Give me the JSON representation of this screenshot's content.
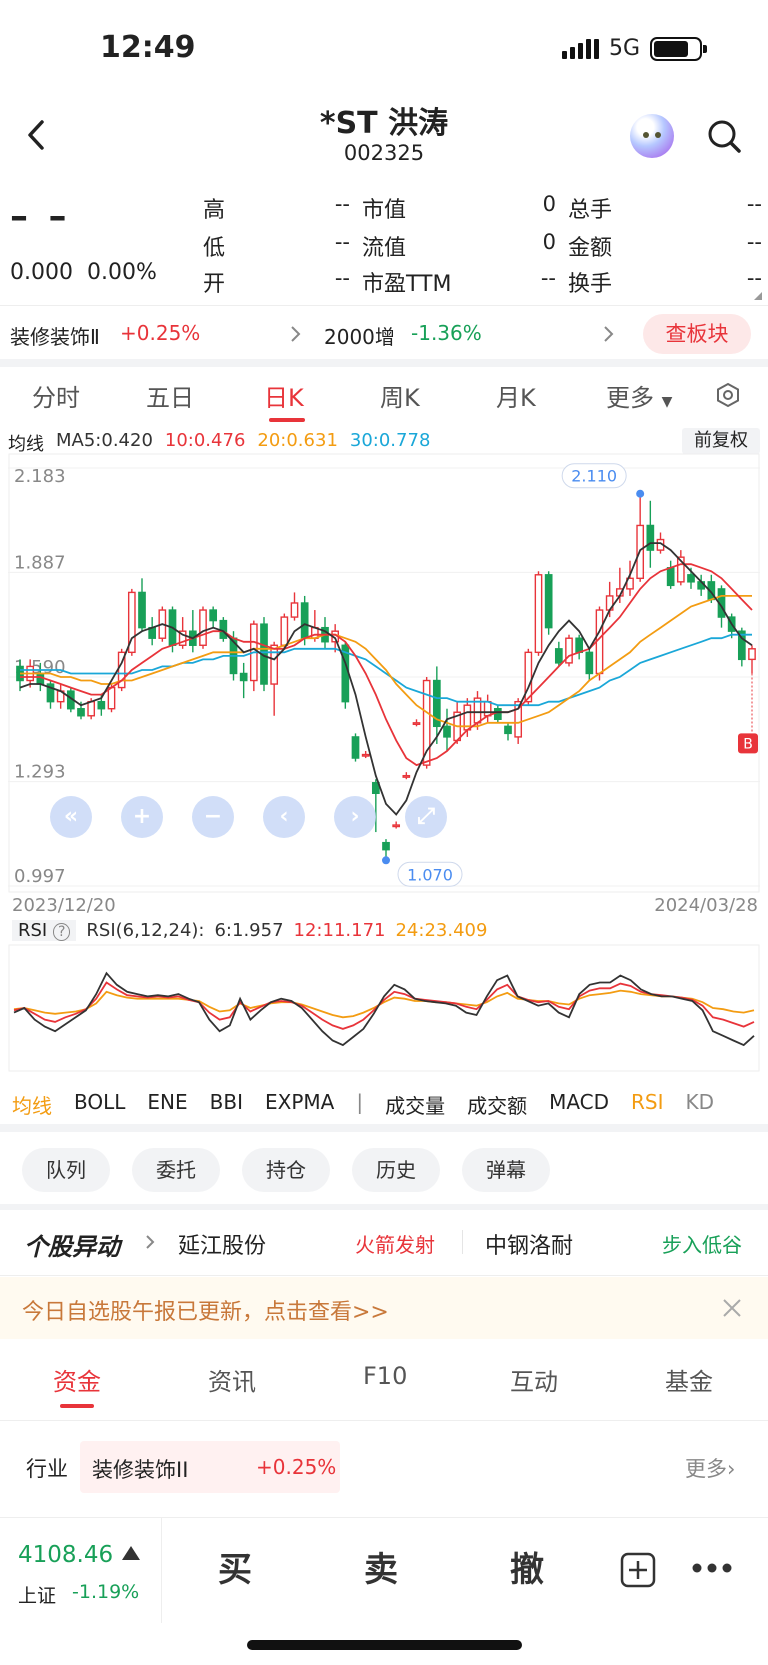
{
  "status_bar": {
    "time": "12:49",
    "network": "5G"
  },
  "header": {
    "title": "*ST 洪涛",
    "code": "002325"
  },
  "quote": {
    "price": "– –",
    "change": "0.000",
    "change_pct": "0.00%",
    "stats": [
      {
        "label": "高",
        "value": "--"
      },
      {
        "label": "低",
        "value": "--"
      },
      {
        "label": "开",
        "value": "--"
      },
      {
        "label": "市值",
        "value": "0"
      },
      {
        "label": "流值",
        "value": "0"
      },
      {
        "label": "市盈TTM",
        "value": "--"
      },
      {
        "label": "总手",
        "value": "--"
      },
      {
        "label": "金额",
        "value": "--"
      },
      {
        "label": "换手",
        "value": "--"
      }
    ]
  },
  "sector": {
    "name": "装修装饰Ⅱ",
    "change": "+0.25%",
    "index_name": "2000增",
    "index_change": "-1.36%",
    "button": "查板块"
  },
  "chart_tabs": [
    "分时",
    "五日",
    "日K",
    "周K",
    "月K",
    "更多"
  ],
  "ma": {
    "label": "均线",
    "ma5": "MA5:0.420",
    "ma10": "10:0.476",
    "ma20": "20:0.631",
    "ma30": "30:0.778",
    "adjust": "前复权"
  },
  "chart_data": [
    {
      "type": "candlestick",
      "y_ticks": [
        "2.183",
        "1.887",
        "1.590",
        "1.293",
        "0.997"
      ],
      "ylim": [
        0.997,
        2.183
      ],
      "x_start": "2023/12/20",
      "x_end": "2024/03/28",
      "high_label": "2.110",
      "low_label": "1.070",
      "colors": {
        "up": "#e8343a",
        "down": "#18a058",
        "ma5": "#333333",
        "ma10": "#e8343a",
        "ma20": "#f39c12",
        "ma30": "#1aa7d8"
      },
      "candles": [
        [
          1.62,
          1.58,
          1.64,
          1.55
        ],
        [
          1.58,
          1.62,
          1.64,
          1.56
        ],
        [
          1.6,
          1.57,
          1.63,
          1.55
        ],
        [
          1.57,
          1.52,
          1.58,
          1.5
        ],
        [
          1.52,
          1.55,
          1.57,
          1.5
        ],
        [
          1.55,
          1.5,
          1.56,
          1.49
        ],
        [
          1.5,
          1.48,
          1.52,
          1.47
        ],
        [
          1.48,
          1.52,
          1.53,
          1.47
        ],
        [
          1.52,
          1.5,
          1.54,
          1.48
        ],
        [
          1.5,
          1.56,
          1.57,
          1.49
        ],
        [
          1.56,
          1.66,
          1.67,
          1.55
        ],
        [
          1.66,
          1.83,
          1.84,
          1.65
        ],
        [
          1.83,
          1.73,
          1.87,
          1.72
        ],
        [
          1.73,
          1.7,
          1.76,
          1.68
        ],
        [
          1.7,
          1.78,
          1.79,
          1.69
        ],
        [
          1.78,
          1.68,
          1.79,
          1.66
        ],
        [
          1.68,
          1.72,
          1.76,
          1.67
        ],
        [
          1.72,
          1.68,
          1.78,
          1.66
        ],
        [
          1.68,
          1.78,
          1.79,
          1.67
        ],
        [
          1.78,
          1.75,
          1.79,
          1.73
        ],
        [
          1.75,
          1.7,
          1.76,
          1.69
        ],
        [
          1.7,
          1.6,
          1.72,
          1.58
        ],
        [
          1.6,
          1.58,
          1.63,
          1.53
        ],
        [
          1.58,
          1.74,
          1.75,
          1.55
        ],
        [
          1.74,
          1.57,
          1.76,
          1.55
        ],
        [
          1.57,
          1.68,
          1.69,
          1.48
        ],
        [
          1.68,
          1.76,
          1.77,
          1.67
        ],
        [
          1.76,
          1.8,
          1.83,
          1.75
        ],
        [
          1.8,
          1.7,
          1.82,
          1.68
        ],
        [
          1.7,
          1.73,
          1.78,
          1.69
        ],
        [
          1.73,
          1.69,
          1.76,
          1.67
        ],
        [
          1.69,
          1.72,
          1.74,
          1.66
        ],
        [
          1.68,
          1.52,
          1.69,
          1.5
        ],
        [
          1.42,
          1.36,
          1.43,
          1.35
        ],
        [
          1.37,
          1.37,
          1.38,
          1.36
        ],
        [
          1.29,
          1.26,
          1.3,
          1.15
        ],
        [
          1.12,
          1.1,
          1.13,
          1.07
        ],
        [
          1.17,
          1.17,
          1.18,
          1.16
        ],
        [
          1.31,
          1.31,
          1.32,
          1.3
        ],
        [
          1.46,
          1.46,
          1.47,
          1.45
        ],
        [
          1.34,
          1.58,
          1.59,
          1.33
        ],
        [
          1.58,
          1.45,
          1.62,
          1.4
        ],
        [
          1.45,
          1.42,
          1.5,
          1.38
        ],
        [
          1.41,
          1.49,
          1.52,
          1.4
        ],
        [
          1.44,
          1.51,
          1.53,
          1.42
        ],
        [
          1.46,
          1.53,
          1.55,
          1.44
        ],
        [
          1.48,
          1.52,
          1.54,
          1.46
        ],
        [
          1.5,
          1.47,
          1.51,
          1.46
        ],
        [
          1.45,
          1.43,
          1.46,
          1.41
        ],
        [
          1.42,
          1.52,
          1.53,
          1.4
        ],
        [
          1.52,
          1.66,
          1.67,
          1.51
        ],
        [
          1.66,
          1.88,
          1.89,
          1.65
        ],
        [
          1.88,
          1.73,
          1.89,
          1.71
        ],
        [
          1.67,
          1.63,
          1.69,
          1.62
        ],
        [
          1.63,
          1.7,
          1.71,
          1.62
        ],
        [
          1.7,
          1.66,
          1.71,
          1.64
        ],
        [
          1.66,
          1.6,
          1.67,
          1.58
        ],
        [
          1.6,
          1.78,
          1.79,
          1.58
        ],
        [
          1.78,
          1.82,
          1.86,
          1.76
        ],
        [
          1.82,
          1.84,
          1.9,
          1.8
        ],
        [
          1.84,
          1.87,
          1.92,
          1.82
        ],
        [
          1.87,
          2.02,
          2.11,
          1.86
        ],
        [
          2.02,
          1.95,
          2.09,
          1.9
        ],
        [
          1.95,
          1.98,
          2.0,
          1.94
        ],
        [
          1.9,
          1.85,
          1.92,
          1.84
        ],
        [
          1.86,
          1.93,
          1.95,
          1.85
        ],
        [
          1.88,
          1.86,
          1.9,
          1.84
        ],
        [
          1.86,
          1.84,
          1.88,
          1.82
        ],
        [
          1.86,
          1.81,
          1.88,
          1.8
        ],
        [
          1.84,
          1.76,
          1.85,
          1.73
        ],
        [
          1.76,
          1.72,
          1.77,
          1.7
        ],
        [
          1.72,
          1.64,
          1.73,
          1.62
        ],
        [
          1.64,
          1.67,
          1.68,
          1.6
        ]
      ],
      "ma5": [
        1.56,
        1.57,
        1.57,
        1.56,
        1.55,
        1.53,
        1.51,
        1.52,
        1.53,
        1.58,
        1.63,
        1.7,
        1.72,
        1.73,
        1.74,
        1.73,
        1.71,
        1.7,
        1.72,
        1.73,
        1.72,
        1.69,
        1.66,
        1.67,
        1.65,
        1.64,
        1.67,
        1.72,
        1.74,
        1.73,
        1.72,
        1.7,
        1.63,
        1.54,
        1.42,
        1.31,
        1.23,
        1.2,
        1.24,
        1.32,
        1.38,
        1.42,
        1.47,
        1.48,
        1.49,
        1.49,
        1.49,
        1.49,
        1.49,
        1.5,
        1.56,
        1.63,
        1.68,
        1.72,
        1.75,
        1.72,
        1.67,
        1.72,
        1.78,
        1.82,
        1.88,
        1.95,
        1.97,
        1.97,
        1.95,
        1.92,
        1.89,
        1.86,
        1.83,
        1.79,
        1.74,
        1.7,
        1.68
      ],
      "ma10": [
        1.59,
        1.59,
        1.59,
        1.58,
        1.57,
        1.56,
        1.55,
        1.54,
        1.54,
        1.56,
        1.58,
        1.61,
        1.63,
        1.65,
        1.67,
        1.68,
        1.69,
        1.7,
        1.71,
        1.72,
        1.72,
        1.7,
        1.69,
        1.69,
        1.68,
        1.67,
        1.67,
        1.68,
        1.7,
        1.71,
        1.71,
        1.71,
        1.69,
        1.65,
        1.6,
        1.54,
        1.47,
        1.41,
        1.36,
        1.34,
        1.35,
        1.36,
        1.38,
        1.41,
        1.44,
        1.46,
        1.48,
        1.49,
        1.49,
        1.5,
        1.53,
        1.56,
        1.59,
        1.62,
        1.65,
        1.66,
        1.67,
        1.7,
        1.73,
        1.76,
        1.8,
        1.84,
        1.87,
        1.89,
        1.9,
        1.91,
        1.91,
        1.9,
        1.89,
        1.87,
        1.84,
        1.81,
        1.78
      ],
      "ma20": [
        1.6,
        1.6,
        1.6,
        1.6,
        1.59,
        1.59,
        1.58,
        1.58,
        1.57,
        1.57,
        1.58,
        1.58,
        1.59,
        1.6,
        1.61,
        1.62,
        1.63,
        1.64,
        1.65,
        1.66,
        1.66,
        1.66,
        1.66,
        1.67,
        1.67,
        1.67,
        1.68,
        1.69,
        1.7,
        1.7,
        1.71,
        1.71,
        1.7,
        1.69,
        1.67,
        1.64,
        1.61,
        1.57,
        1.54,
        1.51,
        1.49,
        1.47,
        1.46,
        1.45,
        1.45,
        1.45,
        1.46,
        1.46,
        1.46,
        1.46,
        1.47,
        1.48,
        1.49,
        1.51,
        1.53,
        1.55,
        1.58,
        1.6,
        1.62,
        1.64,
        1.66,
        1.69,
        1.71,
        1.73,
        1.75,
        1.77,
        1.79,
        1.8,
        1.81,
        1.82,
        1.82,
        1.82,
        1.82
      ],
      "ma30": [
        1.61,
        1.61,
        1.61,
        1.61,
        1.61,
        1.6,
        1.6,
        1.6,
        1.6,
        1.6,
        1.6,
        1.6,
        1.61,
        1.61,
        1.62,
        1.62,
        1.63,
        1.63,
        1.64,
        1.64,
        1.65,
        1.65,
        1.65,
        1.66,
        1.66,
        1.66,
        1.66,
        1.67,
        1.67,
        1.67,
        1.67,
        1.67,
        1.66,
        1.65,
        1.64,
        1.62,
        1.6,
        1.58,
        1.56,
        1.55,
        1.54,
        1.53,
        1.53,
        1.52,
        1.52,
        1.52,
        1.52,
        1.51,
        1.51,
        1.51,
        1.51,
        1.51,
        1.52,
        1.52,
        1.53,
        1.54,
        1.55,
        1.56,
        1.58,
        1.59,
        1.61,
        1.63,
        1.64,
        1.65,
        1.66,
        1.67,
        1.68,
        1.69,
        1.7,
        1.7,
        1.71,
        1.71,
        1.71
      ]
    },
    {
      "type": "line",
      "title": "RSI",
      "series": [
        {
          "name": "6",
          "color": "#333333",
          "values": [
            46,
            50,
            40,
            34,
            30,
            36,
            42,
            48,
            62,
            80,
            70,
            64,
            62,
            60,
            61,
            60,
            62,
            58,
            55,
            40,
            30,
            35,
            58,
            40,
            48,
            55,
            58,
            56,
            50,
            40,
            30,
            22,
            18,
            25,
            32,
            45,
            60,
            70,
            66,
            58,
            56,
            55,
            54,
            52,
            46,
            44,
            60,
            74,
            78,
            60,
            56,
            52,
            54,
            46,
            42,
            62,
            70,
            72,
            72,
            78,
            74,
            66,
            62,
            60,
            60,
            58,
            56,
            48,
            30,
            26,
            22,
            18,
            26
          ]
        },
        {
          "name": "12",
          "color": "#e8343a",
          "values": [
            48,
            50,
            45,
            40,
            38,
            42,
            45,
            49,
            58,
            72,
            66,
            61,
            60,
            59,
            60,
            59,
            60,
            57,
            55,
            46,
            40,
            42,
            55,
            47,
            51,
            55,
            56,
            55,
            52,
            46,
            40,
            35,
            32,
            35,
            40,
            48,
            57,
            64,
            62,
            58,
            57,
            56,
            55,
            54,
            51,
            49,
            57,
            66,
            70,
            60,
            57,
            55,
            56,
            51,
            49,
            60,
            65,
            67,
            67,
            71,
            69,
            64,
            62,
            61,
            60,
            59,
            57,
            52,
            42,
            40,
            37,
            34,
            38
          ]
        },
        {
          "name": "24",
          "color": "#f39c12",
          "values": [
            49,
            50,
            48,
            46,
            45,
            46,
            47,
            49,
            54,
            64,
            61,
            59,
            58,
            58,
            58,
            58,
            58,
            57,
            56,
            51,
            47,
            48,
            54,
            50,
            52,
            54,
            55,
            55,
            53,
            50,
            47,
            44,
            42,
            43,
            46,
            50,
            55,
            59,
            58,
            56,
            56,
            55,
            55,
            54,
            53,
            52,
            55,
            60,
            63,
            58,
            57,
            56,
            56,
            54,
            53,
            58,
            61,
            62,
            63,
            65,
            64,
            62,
            61,
            60,
            60,
            59,
            58,
            55,
            50,
            49,
            47,
            46,
            48
          ]
        }
      ],
      "legend": {
        "label": "RSI",
        "params": "RSI(6,12,24):",
        "v6": "6:1.957",
        "v12": "12:11.171",
        "v24": "24:23.409"
      }
    }
  ],
  "indicators": [
    "均线",
    "BOLL",
    "ENE",
    "BBI",
    "EXPMA",
    "|",
    "成交量",
    "成交额",
    "MACD",
    "RSI",
    "KD"
  ],
  "pills": [
    "队列",
    "委托",
    "持仓",
    "历史",
    "弹幕"
  ],
  "news": {
    "brand": "个股异动",
    "stock1": "延江股份",
    "tag1": "火箭发射",
    "stock2": "中钢洛耐",
    "tag2": "步入低谷"
  },
  "notice": {
    "text": "今日自选股午报已更新，点击查看>>"
  },
  "bottom_tabs": [
    "资金",
    "资讯",
    "F10",
    "互动",
    "基金"
  ],
  "industry": {
    "label": "行业",
    "name": "装修装饰II",
    "change": "+0.25%",
    "more": "更多"
  },
  "index_quote": {
    "value": "4108.46",
    "name": "上证",
    "change": "-1.19%"
  },
  "trade": {
    "buy": "买",
    "sell": "卖",
    "cancel": "撤"
  }
}
